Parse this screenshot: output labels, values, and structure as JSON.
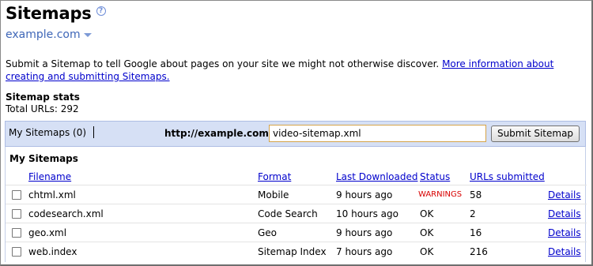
{
  "header": {
    "title": "Sitemaps",
    "help_icon": "?",
    "site": "example.com"
  },
  "intro": {
    "text": "Submit a Sitemap to tell Google about pages on your site we might not otherwise discover.",
    "link_line1": "More information about creating",
    "link_line2": "and submitting Sitemaps."
  },
  "stats": {
    "title": "Sitemap stats",
    "total_urls": "Total URLs: 292"
  },
  "toolbar": {
    "tab_label": "My Sitemaps (0)",
    "base_url": "http://example.com/",
    "input_value": "video-sitemap.xml",
    "submit_label": "Submit Sitemap"
  },
  "panel": {
    "title": "My Sitemaps",
    "columns": {
      "filename": "Filename",
      "format": "Format",
      "last_downloaded": "Last Downloaded",
      "status": "Status",
      "urls_submitted": "URLs submitted"
    },
    "rows": [
      {
        "filename": "chtml.xml",
        "format": "Mobile",
        "last_downloaded": "9 hours ago",
        "status": "WARNINGS",
        "urls": "58",
        "details": "Details"
      },
      {
        "filename": "codesearch.xml",
        "format": "Code Search",
        "last_downloaded": "10 hours ago",
        "status": "OK",
        "urls": "2",
        "details": "Details"
      },
      {
        "filename": "geo.xml",
        "format": "Geo",
        "last_downloaded": "9 hours ago",
        "status": "OK",
        "urls": "16",
        "details": "Details"
      },
      {
        "filename": "web.index",
        "format": "Sitemap Index",
        "last_downloaded": "7 hours ago",
        "status": "OK",
        "urls": "216",
        "details": "Details"
      }
    ]
  },
  "colors": {
    "toolbar_bg": "#d6e0f5",
    "link": "#0000cc",
    "warning": "#d80000",
    "site_name": "#3f67b8"
  }
}
